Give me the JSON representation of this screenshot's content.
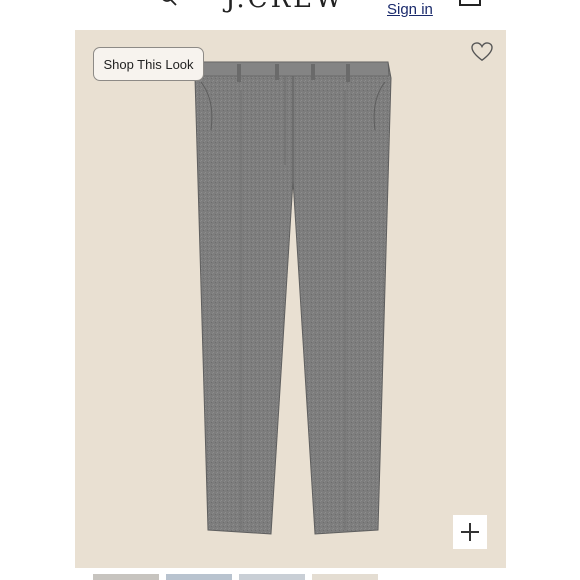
{
  "header": {
    "logo_text": "J.CREW",
    "signin_label": "Sign in",
    "search_icon": "search-icon",
    "bag_icon": "shopping-bag-icon"
  },
  "product_image": {
    "shop_look_label": "Shop This Look",
    "favorite_icon": "heart-icon",
    "zoom_icon": "plus-icon",
    "background_color": "#e9e0d2",
    "item_color": "#7a7a7a"
  },
  "thumbnails": {
    "count_visible": 4
  }
}
